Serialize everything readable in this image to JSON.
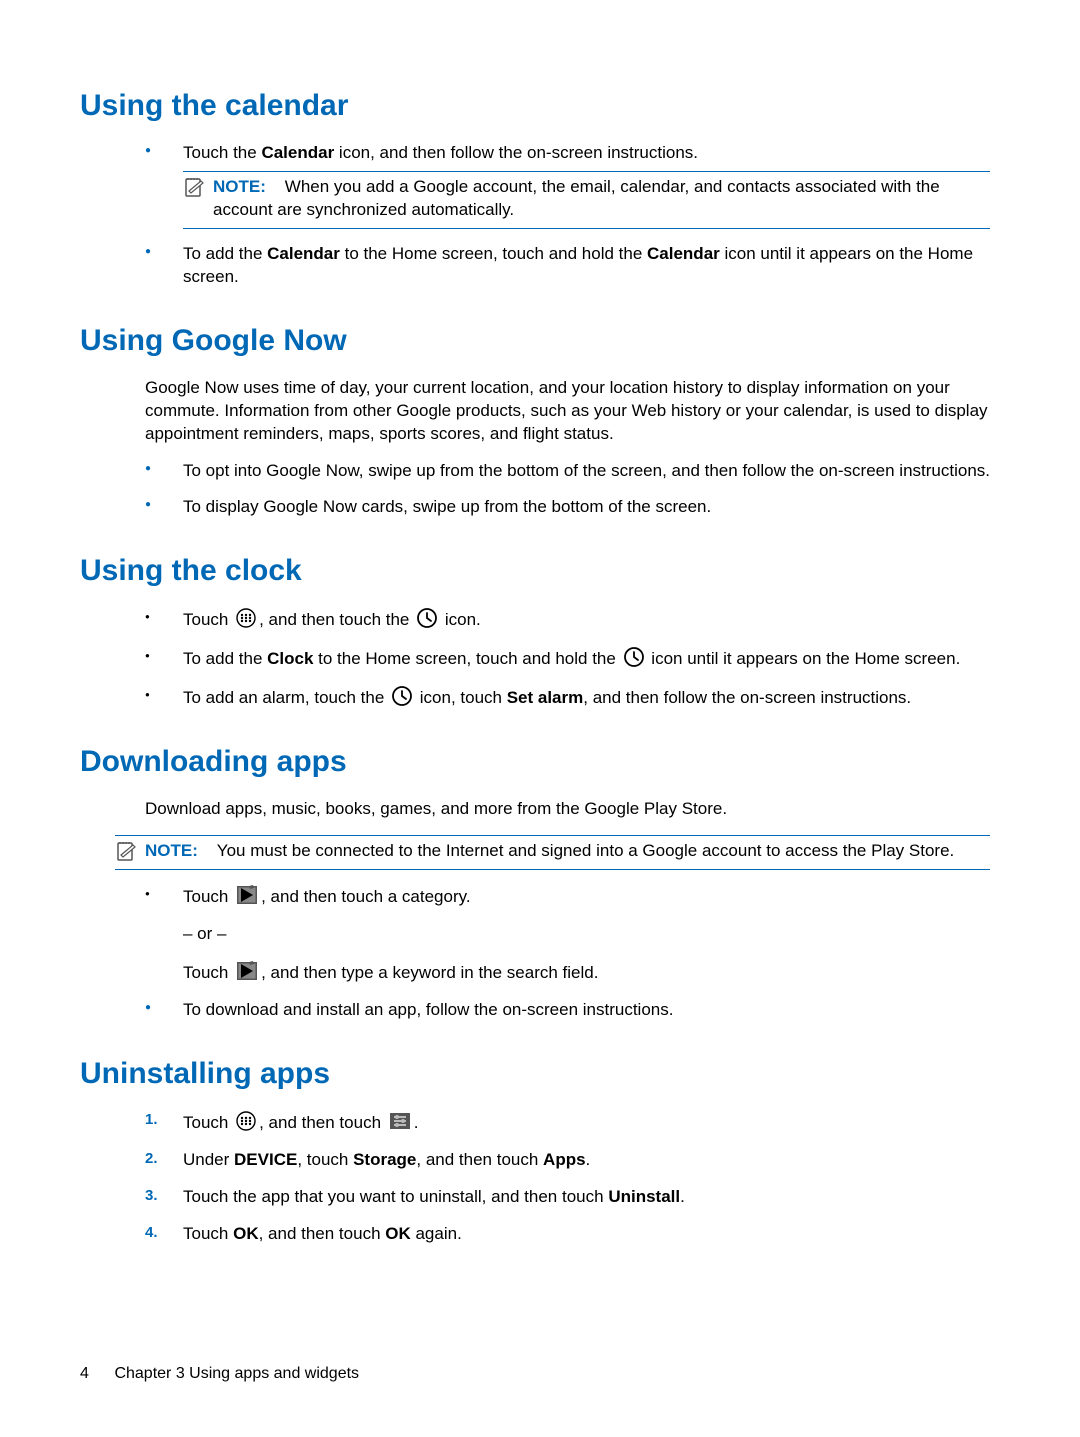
{
  "sections": {
    "calendar": {
      "heading": "Using the calendar",
      "bullet1_pre": "Touch the ",
      "bullet1_strong": "Calendar",
      "bullet1_post": " icon, and then follow the on-screen instructions.",
      "note_label": "NOTE:",
      "note_text": "When you add a Google account, the email, calendar, and contacts associated with the account are synchronized automatically.",
      "bullet2_pre": "To add the ",
      "bullet2_s1": "Calendar",
      "bullet2_mid": " to the Home screen, touch and hold the ",
      "bullet2_s2": "Calendar",
      "bullet2_post": " icon until it appears on the Home screen."
    },
    "now": {
      "heading": "Using Google Now",
      "intro": "Google Now uses time of day, your current location, and your location history to display information on your commute. Information from other Google products, such as your Web history or your calendar, is used to display appointment reminders, maps, sports scores, and flight status.",
      "b1": "To opt into Google Now, swipe up from the bottom of the screen, and then follow the on-screen instructions.",
      "b2": "To display Google Now cards, swipe up from the bottom of the screen."
    },
    "clock": {
      "heading": "Using the clock",
      "b1_pre": "Touch ",
      "b1_mid": ", and then touch the ",
      "b1_post": " icon.",
      "b2_pre": "To add the ",
      "b2_s1": "Clock",
      "b2_mid": " to the Home screen, touch and hold the ",
      "b2_post": " icon until it appears on the Home screen.",
      "b3_pre": "To add an alarm, touch the ",
      "b3_mid": " icon, touch ",
      "b3_s1": "Set alarm",
      "b3_post": ", and then follow the on-screen instructions."
    },
    "download": {
      "heading": "Downloading apps",
      "intro": "Download apps, music, books, games, and more from the Google Play Store.",
      "note_label": "NOTE:",
      "note_text": "You must be connected to the Internet and signed into a Google account to access the Play Store.",
      "b1_pre": "Touch ",
      "b1_post": ", and then touch a category.",
      "or": "– or –",
      "b1b_pre": "Touch ",
      "b1b_post": ", and then type a keyword in the search field.",
      "b2": "To download and install an app, follow the on-screen instructions."
    },
    "uninstall": {
      "heading": "Uninstalling apps",
      "s1_pre": "Touch ",
      "s1_mid": ", and then touch ",
      "s1_post": ".",
      "s2_pre": "Under ",
      "s2_s1": "DEVICE",
      "s2_mid1": ", touch ",
      "s2_s2": "Storage",
      "s2_mid2": ", and then touch ",
      "s2_s3": "Apps",
      "s2_post": ".",
      "s3_pre": "Touch the app that you want to uninstall, and then touch ",
      "s3_s1": "Uninstall",
      "s3_post": ".",
      "s4_pre": "Touch ",
      "s4_s1": "OK",
      "s4_mid": ", and then touch ",
      "s4_s2": "OK",
      "s4_post": " again."
    }
  },
  "footer": {
    "page": "4",
    "chapter": "Chapter 3   Using apps and widgets"
  }
}
